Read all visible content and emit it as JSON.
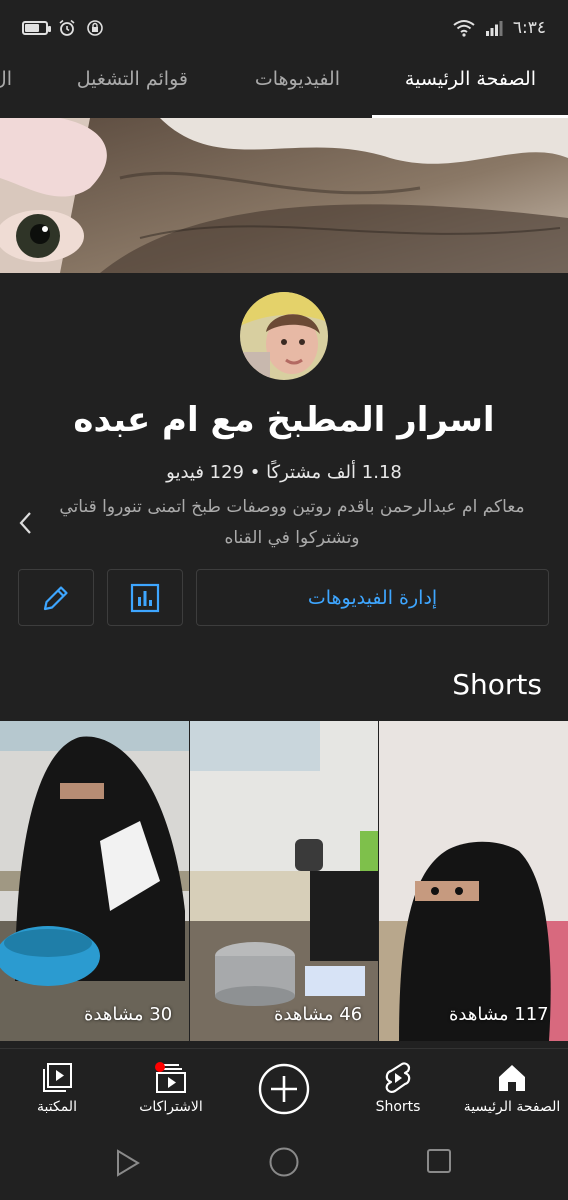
{
  "status_bar": {
    "time": "٦:٣٤",
    "battery_percent": 60
  },
  "tabs": [
    {
      "label": "الصفحة الرئيسية",
      "active": true
    },
    {
      "label": "الفيديوهات",
      "active": false
    },
    {
      "label": "قوائم التشغيل",
      "active": false
    },
    {
      "label": "ال",
      "active": false
    }
  ],
  "channel": {
    "name": "اسرار المطبخ مع ام عبده",
    "stats": "1.18 ألف مشتركًا • 129 فيديو",
    "description": "معاكم ام عبدالرحمن باقدم روتين ووصفات طبخ اتمنى تنوروا قناتي وتشتركوا في القناه"
  },
  "actions": {
    "manage_videos": "إدارة الفيديوهات"
  },
  "shorts": {
    "title": "Shorts",
    "items": [
      {
        "views": "117 مشاهدة"
      },
      {
        "views": "46 مشاهدة"
      },
      {
        "views": "30 مشاهدة"
      }
    ]
  },
  "bottom_nav": {
    "home": "الصفحة الرئيسية",
    "shorts": "Shorts",
    "subscriptions": "الاشتراكات",
    "library": "المكتبة"
  },
  "colors": {
    "accent": "#3ea6ff",
    "background": "#212121",
    "notification": "#ff0000"
  }
}
